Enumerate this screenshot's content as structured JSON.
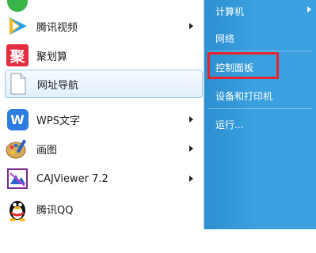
{
  "left_menu": {
    "items": [
      {
        "label": "腾讯视频",
        "icon": "tencent-video-icon",
        "has_submenu": true
      },
      {
        "label": "聚划算",
        "icon": "juhuasuan-icon",
        "has_submenu": false,
        "icon_text": "聚"
      },
      {
        "label": "网址导航",
        "icon": "document-icon",
        "has_submenu": false,
        "highlighted": true
      },
      {
        "label": "WPS文字",
        "icon": "wps-writer-icon",
        "has_submenu": true,
        "icon_text": "W"
      },
      {
        "label": "画图",
        "icon": "paint-icon",
        "has_submenu": true
      },
      {
        "label": "CAJViewer 7.2",
        "icon": "cajviewer-icon",
        "has_submenu": true
      },
      {
        "label": "腾讯QQ",
        "icon": "qq-penguin-icon",
        "has_submenu": false
      }
    ]
  },
  "right_menu": {
    "items": [
      {
        "label": "计算机",
        "has_submenu": true
      },
      {
        "label": "网络",
        "has_submenu": false
      },
      {
        "label": "控制面板",
        "has_submenu": false,
        "highlighted": true
      },
      {
        "label": "设备和打印机",
        "has_submenu": false
      },
      {
        "label": "运行...",
        "has_submenu": false
      }
    ]
  },
  "colors": {
    "right_panel": "#3aa0df",
    "annotation_box": "#e8242c",
    "hover_fill": "#e1effb"
  }
}
